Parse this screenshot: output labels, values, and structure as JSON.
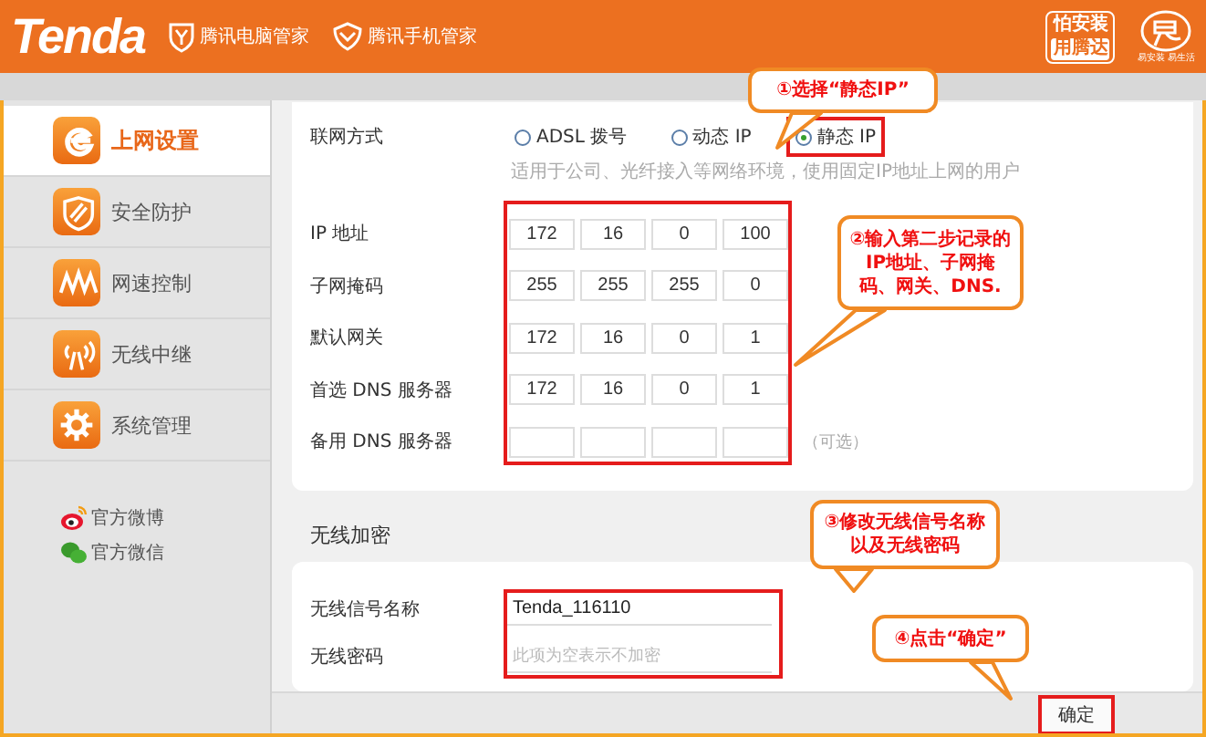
{
  "header": {
    "logo": "Tenda",
    "links": [
      {
        "text": "腾讯电脑管家"
      },
      {
        "text": "腾讯手机管家"
      }
    ],
    "badge": [
      "怕安装",
      "用腾达"
    ],
    "brand_caption": "易安装 易生活"
  },
  "sidebar": {
    "items": [
      {
        "label": "上网设置",
        "selected": true
      },
      {
        "label": "安全防护",
        "selected": false
      },
      {
        "label": "网速控制",
        "selected": false
      },
      {
        "label": "无线中继",
        "selected": false
      },
      {
        "label": "系统管理",
        "selected": false
      }
    ],
    "social": [
      {
        "text": "官方微博"
      },
      {
        "text": "官方微信"
      }
    ]
  },
  "connection": {
    "label": "联网方式",
    "options": [
      {
        "label": "ADSL 拨号",
        "selected": false
      },
      {
        "label": "动态 IP",
        "selected": false
      },
      {
        "label": "静态 IP",
        "selected": true
      }
    ],
    "hint": "适用于公司、光纤接入等网络环境，使用固定IP地址上网的用户"
  },
  "static_fields": [
    {
      "label": "IP 地址",
      "octets": [
        "172",
        "16",
        "0",
        "100"
      ]
    },
    {
      "label": "子网掩码",
      "octets": [
        "255",
        "255",
        "255",
        "0"
      ]
    },
    {
      "label": "默认网关",
      "octets": [
        "172",
        "16",
        "0",
        "1"
      ]
    },
    {
      "label": "首选 DNS 服务器",
      "octets": [
        "172",
        "16",
        "0",
        "1"
      ]
    },
    {
      "label": "备用 DNS 服务器",
      "note": "（可选）"
    }
  ],
  "wireless": {
    "heading": "无线加密",
    "ssid": {
      "label": "无线信号名称",
      "value": "Tenda_116110"
    },
    "password": {
      "label": "无线密码",
      "placeholder": "此项为空表示不加密"
    }
  },
  "footer": {
    "button": "确定"
  },
  "annotations": [
    {
      "text": "①选择“静态IP”"
    },
    {
      "text": "②输入第二步记录的IP地址、子网掩码、网关、DNS."
    },
    {
      "text": "③修改无线信号名称以及无线密码"
    },
    {
      "text": "④点击“确定”"
    }
  ]
}
